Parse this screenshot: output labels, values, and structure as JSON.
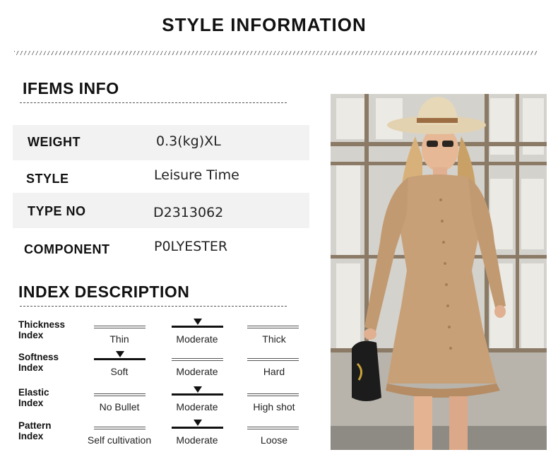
{
  "header": {
    "title": "STYLE INFORMATION"
  },
  "items_info": {
    "heading": "IFEMS INFO",
    "rows": [
      {
        "label": "WEIGHT",
        "value": "0.3(kg)XL"
      },
      {
        "label": "STYLE",
        "value": "Leisure Time"
      },
      {
        "label": "TYPE NO",
        "value": "D2313062"
      },
      {
        "label": "COMPONENT",
        "value": "P0LYESTER"
      }
    ]
  },
  "index_description": {
    "heading": "INDEX DESCRIPTION",
    "rows": [
      {
        "label_line1": "Thickness",
        "label_line2": "Index",
        "options": [
          "Thin",
          "Moderate",
          "Thick"
        ],
        "selected": 1
      },
      {
        "label_line1": "Softness",
        "label_line2": "Index",
        "options": [
          "Soft",
          "Moderate",
          "Hard"
        ],
        "selected": 0
      },
      {
        "label_line1": "Elastic",
        "label_line2": "Index",
        "options": [
          "No Bullet",
          "Moderate",
          "High shot"
        ],
        "selected": 1
      },
      {
        "label_line1": "Pattern",
        "label_line2": "Index",
        "options": [
          "Self cultivation",
          "Moderate",
          "Loose"
        ],
        "selected": 1
      }
    ]
  },
  "colors": {
    "dress": "#c8a078",
    "hat": "#e3d2b0",
    "background": "#ffffff",
    "row_shade": "#f2f2f2"
  }
}
